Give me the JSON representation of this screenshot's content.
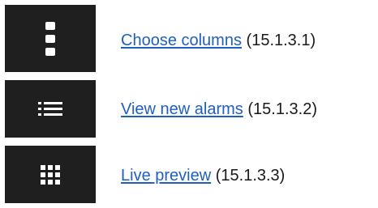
{
  "items": [
    {
      "icon": "vertical-ellipsis-icon",
      "link_text": "Choose columns",
      "ref": "(15.1.3.1)"
    },
    {
      "icon": "list-icon",
      "link_text": "View new alarms",
      "ref": "(15.1.3.2)"
    },
    {
      "icon": "grid-icon",
      "link_text": "Live preview",
      "ref": "(15.1.3.3)"
    }
  ],
  "colors": {
    "tile_bg": "#1f1f1f",
    "icon_fg": "#ffffff",
    "link": "#1f5fbf",
    "text": "#1a1a1a"
  }
}
